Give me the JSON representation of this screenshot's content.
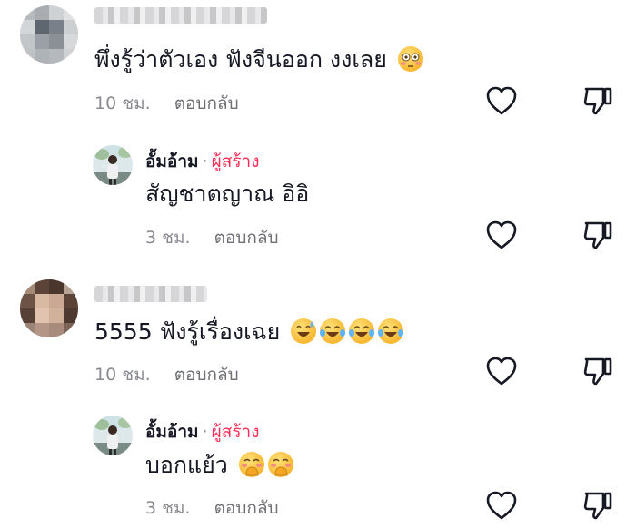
{
  "comments": [
    {
      "text": "พึ่งรู้ว่าตัวเอง ฟังจีนออก งงเลย",
      "time": "10 ชม.",
      "reply_label": "ตอบกลับ",
      "emojis": [
        "flushed-face-emoji"
      ]
    },
    {
      "author": "อั้มอ้าม",
      "separator": "·",
      "creator_badge": "ผู้สร้าง",
      "text": "สัญชาตญาณ อิอิ",
      "time": "3 ชม.",
      "reply_label": "ตอบกลับ"
    },
    {
      "text": "5555 ฟังรู้เรื่องเฉย",
      "time": "10 ชม.",
      "reply_label": "ตอบกลับ",
      "emojis": [
        "grinning-sweat-emoji",
        "tears-of-joy-emoji",
        "tears-of-joy-emoji",
        "tears-of-joy-emoji"
      ]
    },
    {
      "author": "อั้มอ้าม",
      "separator": "·",
      "creator_badge": "ผู้สร้าง",
      "text": "บอกแย้ว",
      "time": "3 ชม.",
      "reply_label": "ตอบกลับ",
      "emojis": [
        "face-with-hand-over-mouth-emoji",
        "face-with-hand-over-mouth-emoji"
      ]
    }
  ],
  "icons": {
    "like": "heart-outline-icon",
    "dislike": "thumbs-down-outline-icon"
  },
  "colors": {
    "text": "#161823",
    "meta": "#8a8b91",
    "creator": "#fe2c55"
  }
}
